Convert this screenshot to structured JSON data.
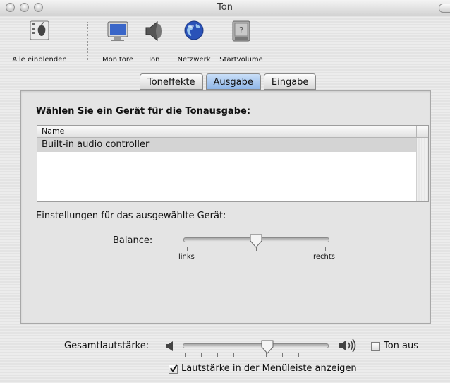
{
  "window": {
    "title": "Ton"
  },
  "toolbar": {
    "items": [
      {
        "label": "Alle einblenden",
        "icon": "show-all-icon"
      },
      {
        "label": "Monitore",
        "icon": "monitor-icon"
      },
      {
        "label": "Ton",
        "icon": "speaker-icon"
      },
      {
        "label": "Netzwerk",
        "icon": "globe-icon"
      },
      {
        "label": "Startvolume",
        "icon": "disk-icon"
      }
    ]
  },
  "tabs": [
    {
      "label": "Toneffekte",
      "active": false
    },
    {
      "label": "Ausgabe",
      "active": true
    },
    {
      "label": "Eingabe",
      "active": false
    }
  ],
  "output": {
    "section_title": "Wählen Sie ein Gerät für die Tonausgabe:",
    "list_header": "Name",
    "devices": [
      "Built-in audio controller"
    ],
    "settings_label": "Einstellungen für das ausgewählte Gerät:",
    "balance": {
      "label": "Balance:",
      "left": "links",
      "right": "rechts",
      "value": 0.5
    }
  },
  "volume": {
    "label": "Gesamtlautstärke:",
    "value": 0.57,
    "mute_label": "Ton aus",
    "mute_checked": false,
    "menubar_label": "Lautstärke in der Menüleiste anzeigen",
    "menubar_checked": true
  },
  "colors": {
    "active_tab": "#9cc0ee",
    "selected_row": "#d4d4d4"
  }
}
